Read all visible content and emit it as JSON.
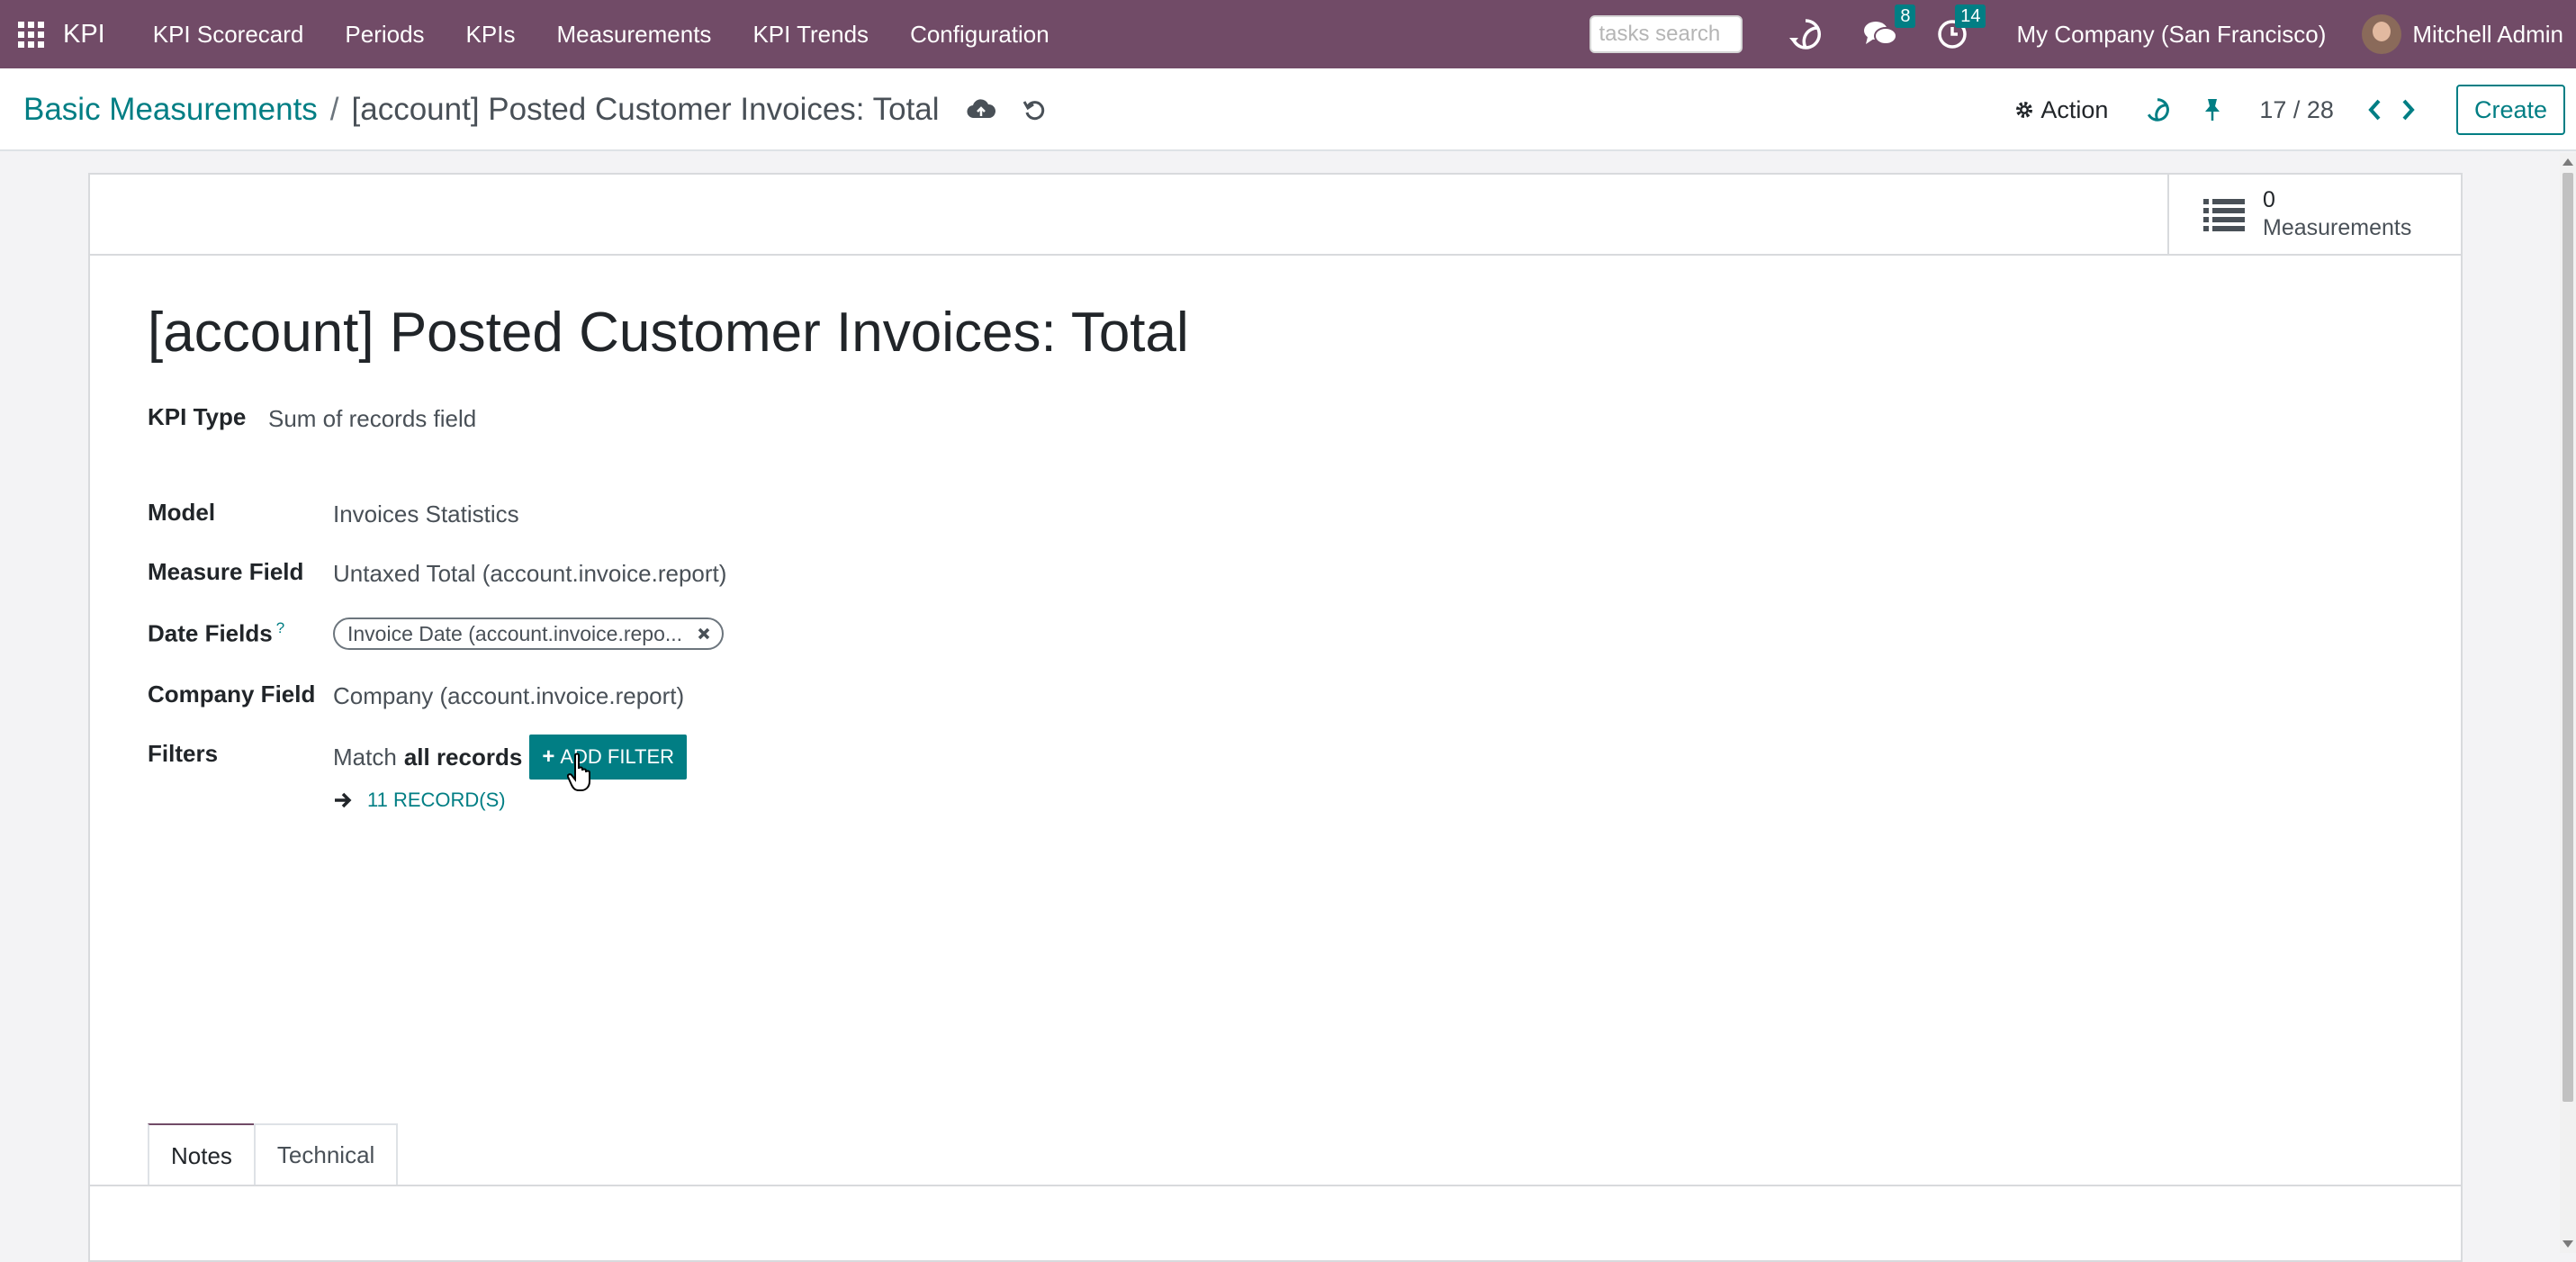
{
  "navbar": {
    "app_name": "KPI",
    "menu": [
      "KPI Scorecard",
      "Periods",
      "KPIs",
      "Measurements",
      "KPI Trends",
      "Configuration"
    ],
    "search_placeholder": "tasks search",
    "messages_count": "8",
    "activities_count": "14",
    "company": "My Company (San Francisco)",
    "user": "Mitchell Admin"
  },
  "control": {
    "breadcrumb_parent": "Basic Measurements",
    "breadcrumb_separator": "/",
    "breadcrumb_current": "[account] Posted Customer Invoices: Total",
    "action_label": "Action",
    "pager": "17 / 28",
    "create_label": "Create"
  },
  "form": {
    "stat_button": {
      "value": "0",
      "label": "Measurements"
    },
    "title": "[account] Posted Customer Invoices: Total",
    "fields": {
      "kpi_type_label": "KPI Type",
      "kpi_type_value": "Sum of records field",
      "model_label": "Model",
      "model_value": "Invoices Statistics",
      "measure_label": "Measure Field",
      "measure_value": "Untaxed Total (account.invoice.report)",
      "date_fields_label": "Date Fields",
      "date_fields_help": "?",
      "date_fields_tag": "Invoice Date (account.invoice.repo...",
      "company_label": "Company Field",
      "company_value": "Company (account.invoice.report)",
      "filters_label": "Filters",
      "filters_match": "Match",
      "filters_scope": "all records",
      "add_filter_label": "ADD FILTER",
      "records_link": "11 RECORD(S)"
    },
    "tabs": [
      "Notes",
      "Technical"
    ],
    "active_tab": "Notes"
  },
  "colors": {
    "brand": "#714b67",
    "accent": "#017e84"
  }
}
